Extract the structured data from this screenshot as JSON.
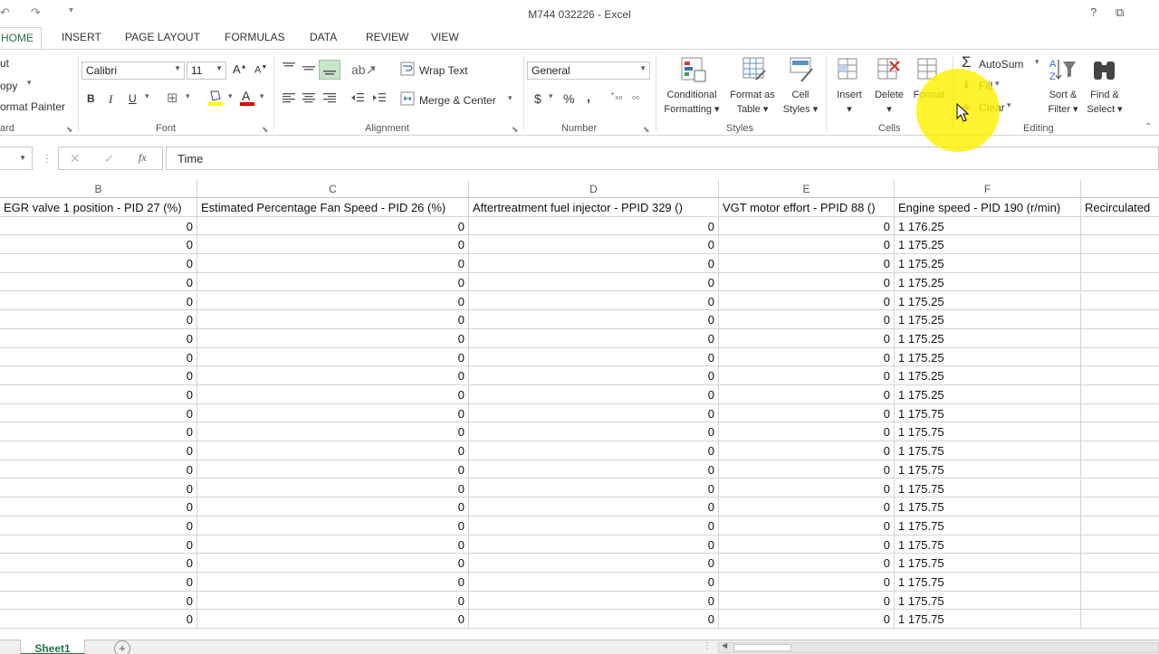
{
  "window": {
    "title": "M744 032226 - Excel",
    "help": "?",
    "restore": "⧉"
  },
  "tabs": [
    "HOME",
    "INSERT",
    "PAGE LAYOUT",
    "FORMULAS",
    "DATA",
    "REVIEW",
    "VIEW"
  ],
  "ribbon": {
    "clipboard": {
      "cut": "ut",
      "copy": "opy",
      "format_painter": "ormat Painter",
      "label": "ard"
    },
    "font": {
      "name": "Calibri",
      "size": "11",
      "bold": "B",
      "italic": "I",
      "underline": "U",
      "label": "Font"
    },
    "alignment": {
      "wrap_text": "Wrap Text",
      "merge_center": "Merge & Center",
      "label": "Alignment"
    },
    "number": {
      "format": "General",
      "currency": "$",
      "percent": "%",
      "comma": ",",
      "label": "Number"
    },
    "styles": {
      "conditional": [
        "Conditional",
        "Formatting"
      ],
      "format_table": [
        "Format as",
        "Table"
      ],
      "cell_styles": [
        "Cell",
        "Styles"
      ],
      "label": "Styles"
    },
    "cells": {
      "insert": "Insert",
      "delete": "Delete",
      "format": "Format",
      "label": "Cells"
    },
    "editing": {
      "autosum": "AutoSum",
      "fill": "Fill",
      "clear": "Clear",
      "sort": [
        "Sort &",
        "Filter"
      ],
      "find": [
        "Find &",
        "Select"
      ],
      "label": "Editing"
    }
  },
  "formula_bar": {
    "fx": "fx",
    "value": "Time"
  },
  "columns": [
    {
      "letter": "B",
      "header": "EGR valve 1 position - PID 27 (%)"
    },
    {
      "letter": "C",
      "header": "Estimated Percentage Fan Speed - PID 26 (%)"
    },
    {
      "letter": "D",
      "header": "Aftertreatment fuel injector - PPID 329 ()"
    },
    {
      "letter": "E",
      "header": "VGT motor effort - PPID 88 ()"
    },
    {
      "letter": "F",
      "header": "Engine speed - PID 190 (r/min)"
    },
    {
      "letter": "",
      "header": "Recirculated"
    }
  ],
  "rows": [
    [
      "0",
      "0",
      "0",
      "0",
      "1 176.25"
    ],
    [
      "0",
      "0",
      "0",
      "0",
      "1 175.25"
    ],
    [
      "0",
      "0",
      "0",
      "0",
      "1 175.25"
    ],
    [
      "0",
      "0",
      "0",
      "0",
      "1 175.25"
    ],
    [
      "0",
      "0",
      "0",
      "0",
      "1 175.25"
    ],
    [
      "0",
      "0",
      "0",
      "0",
      "1 175.25"
    ],
    [
      "0",
      "0",
      "0",
      "0",
      "1 175.25"
    ],
    [
      "0",
      "0",
      "0",
      "0",
      "1 175.25"
    ],
    [
      "0",
      "0",
      "0",
      "0",
      "1 175.25"
    ],
    [
      "0",
      "0",
      "0",
      "0",
      "1 175.25"
    ],
    [
      "0",
      "0",
      "0",
      "0",
      "1 175.75"
    ],
    [
      "0",
      "0",
      "0",
      "0",
      "1 175.75"
    ],
    [
      "0",
      "0",
      "0",
      "0",
      "1 175.75"
    ],
    [
      "0",
      "0",
      "0",
      "0",
      "1 175.75"
    ],
    [
      "0",
      "0",
      "0",
      "0",
      "1 175.75"
    ],
    [
      "0",
      "0",
      "0",
      "0",
      "1 175.75"
    ],
    [
      "0",
      "0",
      "0",
      "0",
      "1 175.75"
    ],
    [
      "0",
      "0",
      "0",
      "0",
      "1 175.75"
    ],
    [
      "0",
      "0",
      "0",
      "0",
      "1 175.75"
    ],
    [
      "0",
      "0",
      "0",
      "0",
      "1 175.75"
    ],
    [
      "0",
      "0",
      "0",
      "0",
      "1 175.75"
    ],
    [
      "0",
      "0",
      "0",
      "0",
      "1 175.75"
    ]
  ],
  "sheets": {
    "active": "Sheet1",
    "add": "+"
  },
  "colors": {
    "accent": "#217346",
    "highlight": "#fff000"
  }
}
